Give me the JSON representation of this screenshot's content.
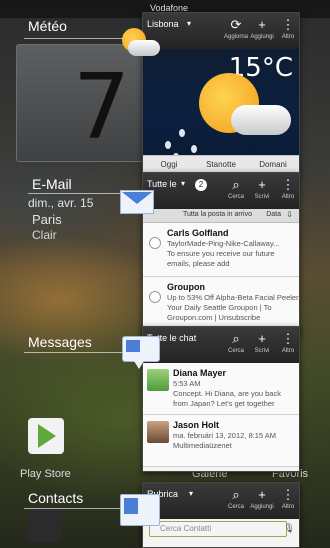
{
  "status_bar": {
    "network": "Vodafone"
  },
  "home": {
    "clock_digit": "7",
    "date": "dim., avr. 15",
    "city": "Paris",
    "condition": "Clair",
    "apps": {
      "play_store": "Play Store",
      "galerie": "Galerie",
      "favoris": "Favoris"
    }
  },
  "sections": {
    "meteo": "Météo",
    "email": "E-Mail",
    "messages": "Messages",
    "contacts": "Contacts"
  },
  "weather_card": {
    "location": "Lisbona",
    "actions": {
      "update": "Aggiorna",
      "add": "Aggiungi",
      "more": "Altro"
    },
    "temperature": "15°C",
    "tabs": [
      "Oggi",
      "Stanotte",
      "Domani"
    ]
  },
  "email_card": {
    "account": "Tutte le",
    "unread": "2",
    "actions": {
      "search": "Cerca",
      "compose": "Scrivi",
      "more": "Altro"
    },
    "folder_label": "Tutta la posta in arrivo",
    "folder_date": "Data",
    "items": [
      {
        "from": "Carls Golfland",
        "lines": [
          "TaylorMade-Ping-Nike-Callaway...",
          "To ensure you receive our future",
          "emails, please add"
        ]
      },
      {
        "from": "Groupon",
        "lines": [
          "Up to 53% Off Alpha-Beta Facial Peeler...",
          "Your Daily Seattle Groupon | To",
          "Groupon.com | Unsubscribe"
        ]
      }
    ]
  },
  "messages_card": {
    "header": "Tutte le chat",
    "actions": {
      "search": "Cerca",
      "compose": "Scrivi",
      "more": "Altro"
    },
    "items": [
      {
        "name": "Diana Mayer",
        "time": "5:53 AM",
        "lines": [
          "Concept. Hi Diana, are you back",
          "from Japan? Let's get together"
        ]
      },
      {
        "name": "Jason Holt",
        "time": "ma. februári 13, 2012, 8:15 AM",
        "lines": [
          "Multimediaüzenet"
        ]
      }
    ]
  },
  "contacts_card": {
    "header": "Rubrica",
    "actions": {
      "search": "Cerca",
      "add": "Aggiungi",
      "more": "Altro"
    },
    "search_placeholder": "Cerca Contatti"
  }
}
